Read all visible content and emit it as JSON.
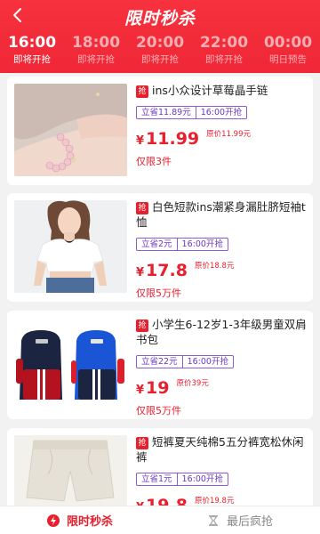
{
  "header": {
    "title": "限时秒杀"
  },
  "time_slots": [
    {
      "time": "16:00",
      "status": "即将开抢",
      "active": true
    },
    {
      "time": "18:00",
      "status": "即将开抢",
      "active": false
    },
    {
      "time": "20:00",
      "status": "即将开抢",
      "active": false
    },
    {
      "time": "22:00",
      "status": "即将开抢",
      "active": false
    },
    {
      "time": "00:00",
      "status": "明日预告",
      "active": false
    }
  ],
  "products": [
    {
      "badge": "抢",
      "name": "ins小众设计草莓晶手链",
      "save": "立省11.89元",
      "start": "16:00开抢",
      "currency": "¥",
      "price": "11.99",
      "original": "原价11.99元",
      "limit": "仅限3件",
      "image": "bracelet-photo"
    },
    {
      "badge": "抢",
      "name": "白色短款ins潮紧身漏肚脐短袖t恤",
      "save": "立省2元",
      "start": "16:00开抢",
      "currency": "¥",
      "price": "17.8",
      "original": "原价18.8元",
      "limit": "仅限5万件",
      "image": "white-tshirt-photo"
    },
    {
      "badge": "抢",
      "name": "小学生6-12岁1-3年级男童双肩书包",
      "save": "立省22元",
      "start": "16:00开抢",
      "currency": "¥",
      "price": "19",
      "original": "原价39元",
      "limit": "仅限5万件",
      "image": "school-backpack-photo"
    },
    {
      "badge": "抢",
      "name": "短裤夏天纯棉5五分裤宽松休闲裤",
      "save": "立省1元",
      "start": "16:00开抢",
      "currency": "¥",
      "price": "19.8",
      "original": "原价19.8元",
      "limit": "",
      "image": "white-shorts-photo"
    }
  ],
  "tabbar": {
    "flash_sale": "限时秒杀",
    "last_chance": "最后疯抢"
  },
  "colors": {
    "brand_red": "#e8202e",
    "header_red": "#f7313d",
    "tag_purple": "#8e5ad6"
  }
}
